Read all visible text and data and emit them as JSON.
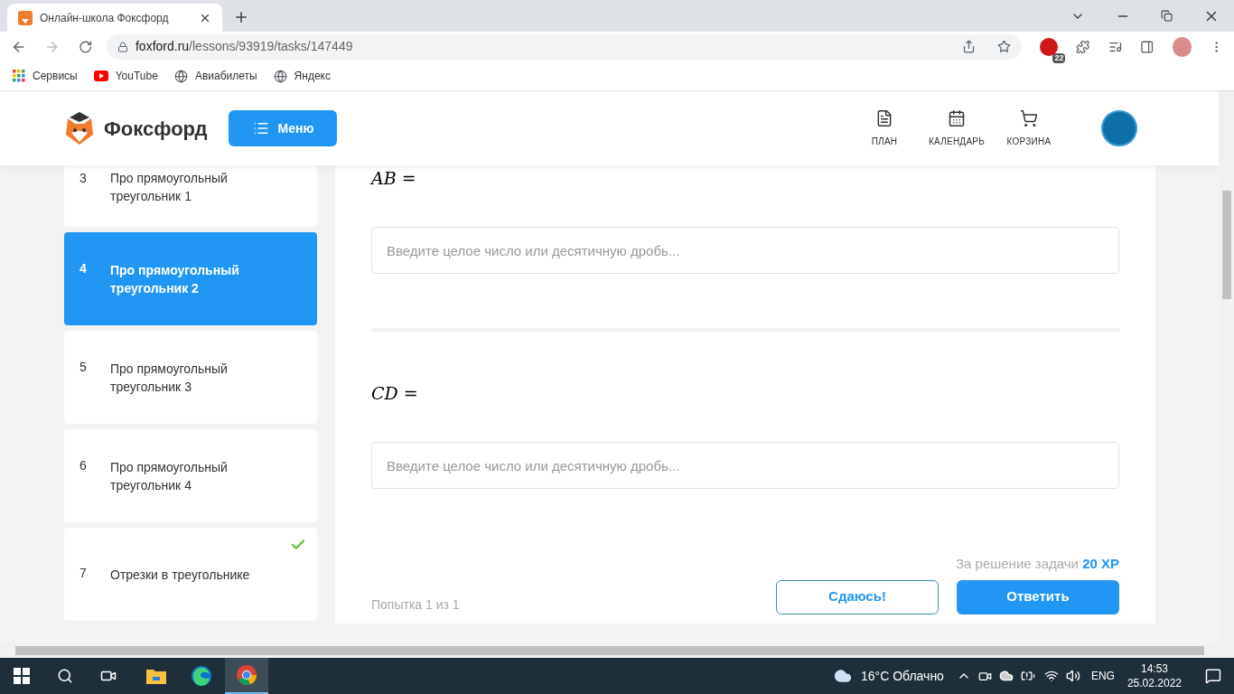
{
  "browser": {
    "tabs": [
      {
        "title": "Онлайн-школа Фоксфорд",
        "selected": true
      }
    ],
    "url_host": "foxford.ru",
    "url_path": "/lessons/93919/tasks/147449",
    "extension_badge": "22",
    "bookmarks": [
      {
        "label": "Сервисы",
        "kind": "apps"
      },
      {
        "label": "YouTube",
        "kind": "youtube"
      },
      {
        "label": "Авиабилеты",
        "kind": "globe"
      },
      {
        "label": "Яндекс",
        "kind": "globe"
      }
    ]
  },
  "header": {
    "logo": "Фоксфорд",
    "menu_button": "Меню",
    "nav": [
      {
        "label": "ПЛАН",
        "kind": "plan"
      },
      {
        "label": "КАЛЕНДАРЬ",
        "kind": "calendar"
      },
      {
        "label": "КОРЗИНА",
        "kind": "cart"
      }
    ]
  },
  "sidebar": {
    "items": [
      {
        "number": "3",
        "title": "Про прямоугольный треугольник 1",
        "selected": false,
        "completed": false
      },
      {
        "number": "4",
        "title": "Про прямоугольный треугольник 2",
        "selected": true,
        "completed": false
      },
      {
        "number": "5",
        "title": "Про прямоугольный треугольник 3",
        "selected": false,
        "completed": false
      },
      {
        "number": "6",
        "title": "Про прямоугольный треугольник 4",
        "selected": false,
        "completed": false
      },
      {
        "number": "7",
        "title": "Отрезки в треугольнике",
        "selected": false,
        "completed": true
      }
    ]
  },
  "task": {
    "fields": [
      {
        "label": "*AB* =",
        "placeholder": "Введите целое число или десятичную дробь..."
      },
      {
        "label": "*CD* =",
        "placeholder": "Введите целое число или десятичную дробь..."
      }
    ],
    "reward": "За решение задачи",
    "reward_xp": "20 XP",
    "give_up_button": "Сдаюсь!",
    "answer_button": "Ответить",
    "attempt": "Попытка 1 из 1"
  },
  "taskbar": {
    "apps": [
      {
        "kind": "explorer",
        "selected": false
      },
      {
        "kind": "edge",
        "selected": false
      },
      {
        "kind": "chrome",
        "selected": true
      }
    ],
    "weather": "16°C Облачно",
    "language": "ENG",
    "time": "14:53",
    "date": "25.02.2022"
  }
}
